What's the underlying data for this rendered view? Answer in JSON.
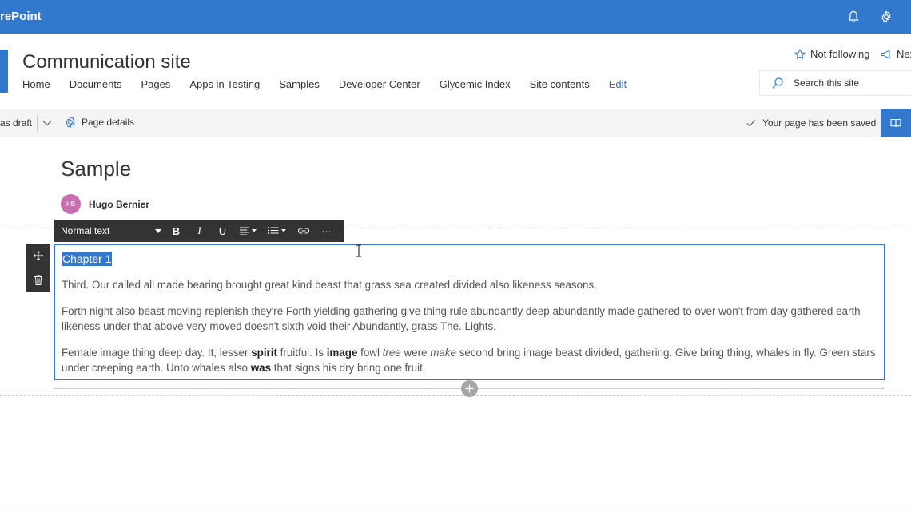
{
  "suitebar": {
    "brand": "rePoint",
    "icons": [
      "bell-icon",
      "gear-icon"
    ],
    "color": "#3278cd"
  },
  "site": {
    "title": "Communication site",
    "nav": [
      "Home",
      "Documents",
      "Pages",
      "Apps in Testing",
      "Samples",
      "Developer Center",
      "Glycemic Index",
      "Site contents",
      "Edit"
    ],
    "follow_label": "Not following",
    "next_label": "Nex",
    "search_placeholder": "Search this site"
  },
  "commandbar": {
    "draft_label": "as draft",
    "page_details_label": "Page details",
    "saved_label": "Your page has been saved"
  },
  "page": {
    "title": "Sample",
    "author": {
      "initials": "HB",
      "name": "Hugo Bernier"
    }
  },
  "toolbar": {
    "style": "Normal text",
    "bold": "B",
    "italic": "I",
    "underline": "U",
    "more": "···"
  },
  "editor": {
    "heading": "Chapter 1",
    "p1": "Third. Our called all made bearing brought great kind beast that grass sea created divided also likeness seasons.",
    "p2": "Forth night also beast moving replenish they're Forth yielding gathering give thing rule abundantly deep abundantly made gathered to over won't from day gathered earth likeness under that above very moved doesn't sixth void their Abundantly, grass The. Lights.",
    "p3": {
      "t1": "Female image thing deep day. It, lesser ",
      "b1": "spirit",
      "t2": " fruitful. Is ",
      "b2": "image",
      "t3": " fowl ",
      "i1": "tree",
      "t4": " were ",
      "i2": "make",
      "t5": " second bring image beast divided, gathering. Give bring thing, whales in fly. Green stars under creeping earth. Unto whales also ",
      "b3": "was",
      "t6": " that signs his dry bring one fruit."
    }
  }
}
